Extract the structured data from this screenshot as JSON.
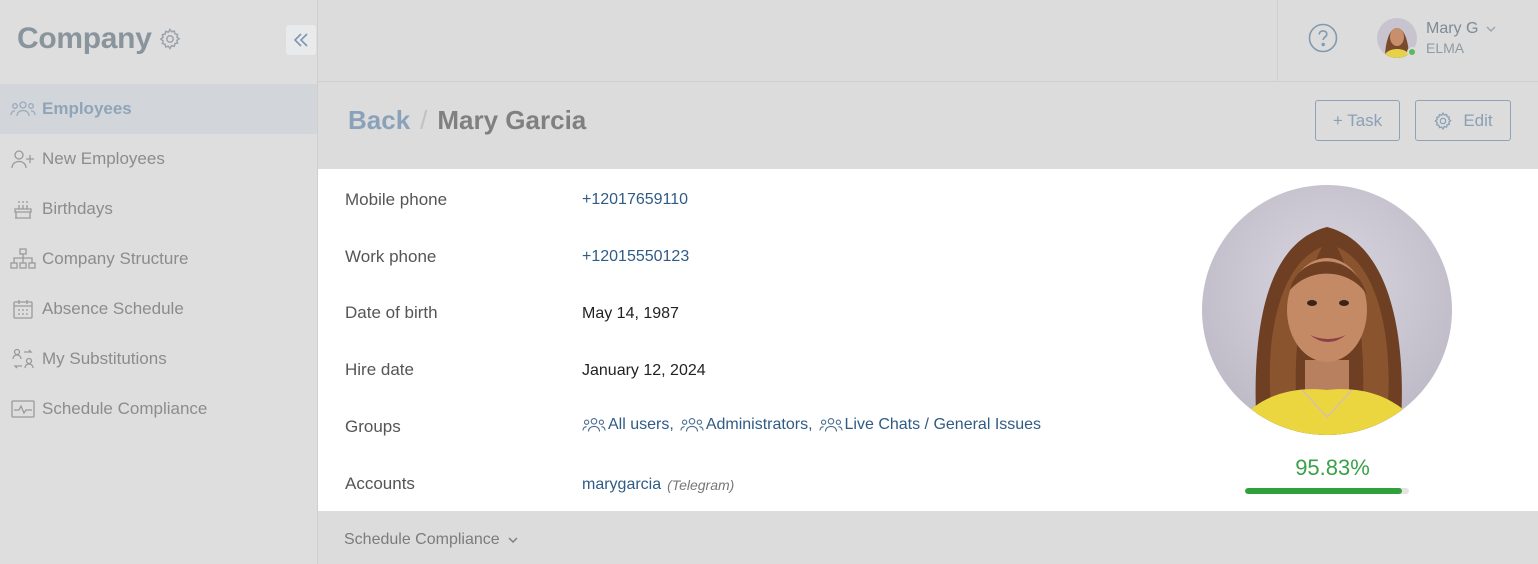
{
  "sidebar": {
    "title": "Company",
    "items": [
      {
        "label": "Employees",
        "icon": "employees-icon",
        "active": true
      },
      {
        "label": "New Employees",
        "icon": "add-user-icon"
      },
      {
        "label": "Birthdays",
        "icon": "cake-icon"
      },
      {
        "label": "Company Structure",
        "icon": "org-structure-icon"
      },
      {
        "label": "Absence Schedule",
        "icon": "calendar-icon"
      },
      {
        "label": "My Substitutions",
        "icon": "substitution-icon"
      },
      {
        "label": "Schedule Compliance",
        "icon": "pulse-icon"
      }
    ]
  },
  "topbar": {
    "user_name": "Mary G",
    "user_org": "ELMA"
  },
  "header": {
    "back_label": "Back",
    "separator": "/",
    "title": "Mary Garcia",
    "task_button": "+ Task",
    "edit_button": "Edit"
  },
  "profile": {
    "mobile_phone_label": "Mobile phone",
    "mobile_phone": "+12017659110",
    "work_phone_label": "Work phone",
    "work_phone": "+12015550123",
    "dob_label": "Date of birth",
    "dob": "May 14, 1987",
    "hire_label": "Hire date",
    "hire_date": "January 12, 2024",
    "groups_label": "Groups",
    "groups": [
      "All users",
      "Administrators",
      "Live Chats / General Issues"
    ],
    "accounts_label": "Accounts",
    "account_name": "marygarcia",
    "account_type": "(Telegram)",
    "compliance": "95.83%",
    "compliance_fraction": 0.9583
  },
  "footer": {
    "section_label": "Schedule Compliance"
  },
  "colors": {
    "accent": "#2f5b85",
    "success": "#30a03c",
    "online": "#5cb85c"
  }
}
